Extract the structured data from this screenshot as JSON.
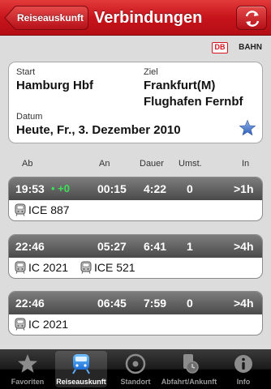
{
  "nav": {
    "back_label": "Reiseauskunft",
    "title": "Verbindungen"
  },
  "brand": {
    "logo_box": "DB",
    "logo_text": "BAHN",
    "color": "#d4141c"
  },
  "journey": {
    "start_label": "Start",
    "start_value": "Hamburg Hbf",
    "ziel_label": "Ziel",
    "ziel_line1": "Frankfurt(M)",
    "ziel_line2": "Flughafen Fernbf",
    "datum_label": "Datum",
    "datum_value": "Heute, Fr., 3. Dezember 2010",
    "favorite_icon": "star-icon"
  },
  "columns": {
    "ab": "Ab",
    "an": "An",
    "dauer": "Dauer",
    "umst": "Umst.",
    "in": "In"
  },
  "connections": [
    {
      "dep": "19:53",
      "delay": "+0",
      "arr": "00:15",
      "duration": "4:22",
      "changes": "0",
      "in": ">1h",
      "trains": [
        "ICE 887"
      ]
    },
    {
      "dep": "22:46",
      "delay": "",
      "arr": "05:27",
      "duration": "6:41",
      "changes": "1",
      "in": ">4h",
      "trains": [
        "IC 2021",
        "ICE 521"
      ]
    },
    {
      "dep": "22:46",
      "delay": "",
      "arr": "06:45",
      "duration": "7:59",
      "changes": "0",
      "in": ">4h",
      "trains": [
        "IC 2021"
      ]
    }
  ],
  "tabs": [
    {
      "label": "Favoriten",
      "icon": "star-icon"
    },
    {
      "label": "Reiseauskunft",
      "icon": "train-icon",
      "active": true
    },
    {
      "label": "Standort",
      "icon": "location-icon"
    },
    {
      "label": "Abfahrt/Ankunft",
      "icon": "departure-board-icon"
    },
    {
      "label": "Info",
      "icon": "info-icon"
    }
  ],
  "colors": {
    "accent_red": "#c8141c",
    "delay_green": "#3ee05a"
  }
}
